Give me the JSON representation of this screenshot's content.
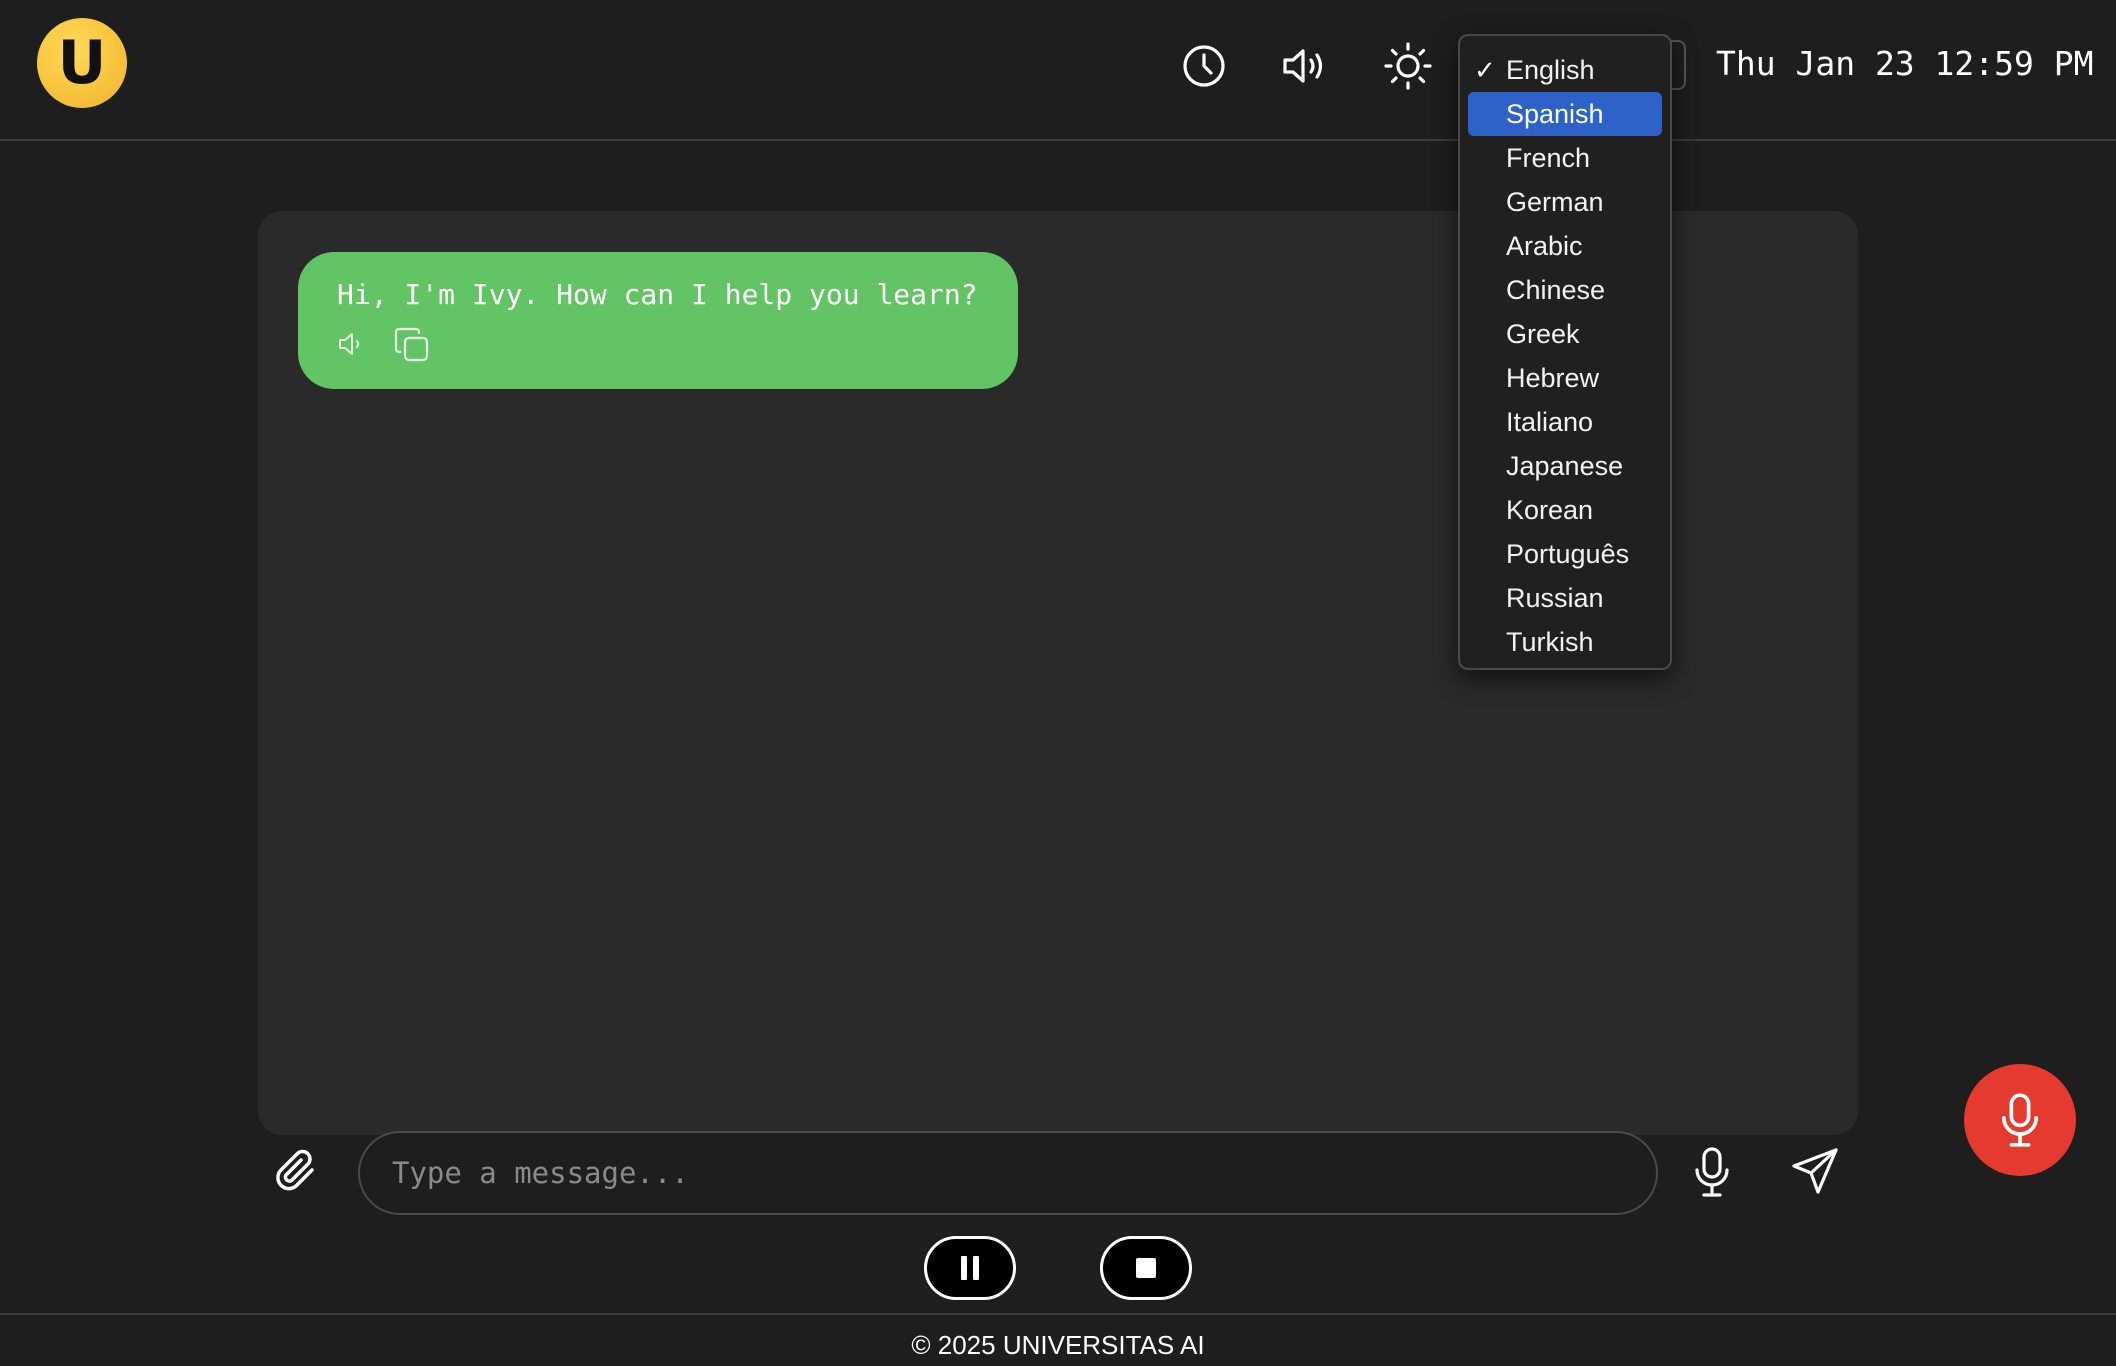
{
  "header": {
    "logo_letter": "U",
    "datetime": "Thu Jan 23 12:59 PM",
    "icons": [
      "history-icon",
      "speaker-icon",
      "sun-icon"
    ]
  },
  "language_dropdown": {
    "selected": "English",
    "highlighted": "Spanish",
    "check_mark": "✓",
    "options": [
      "English",
      "Spanish",
      "French",
      "German",
      "Arabic",
      "Chinese",
      "Greek",
      "Hebrew",
      "Italiano",
      "Japanese",
      "Korean",
      "Português",
      "Russian",
      "Turkish"
    ]
  },
  "chat": {
    "messages": [
      {
        "sender": "Ivy",
        "text": "Hi, I'm Ivy. How can I help you learn?"
      }
    ]
  },
  "composer": {
    "placeholder": "Type a message..."
  },
  "footer": {
    "text": "© 2025 UNIVERSITAS AI"
  },
  "colors": {
    "background": "#1e1e1e",
    "panel": "#2a2a2a",
    "bubble": "#63c466",
    "logo": "#f7c23b",
    "highlight": "#2f62c8",
    "record": "#e53a2f"
  }
}
